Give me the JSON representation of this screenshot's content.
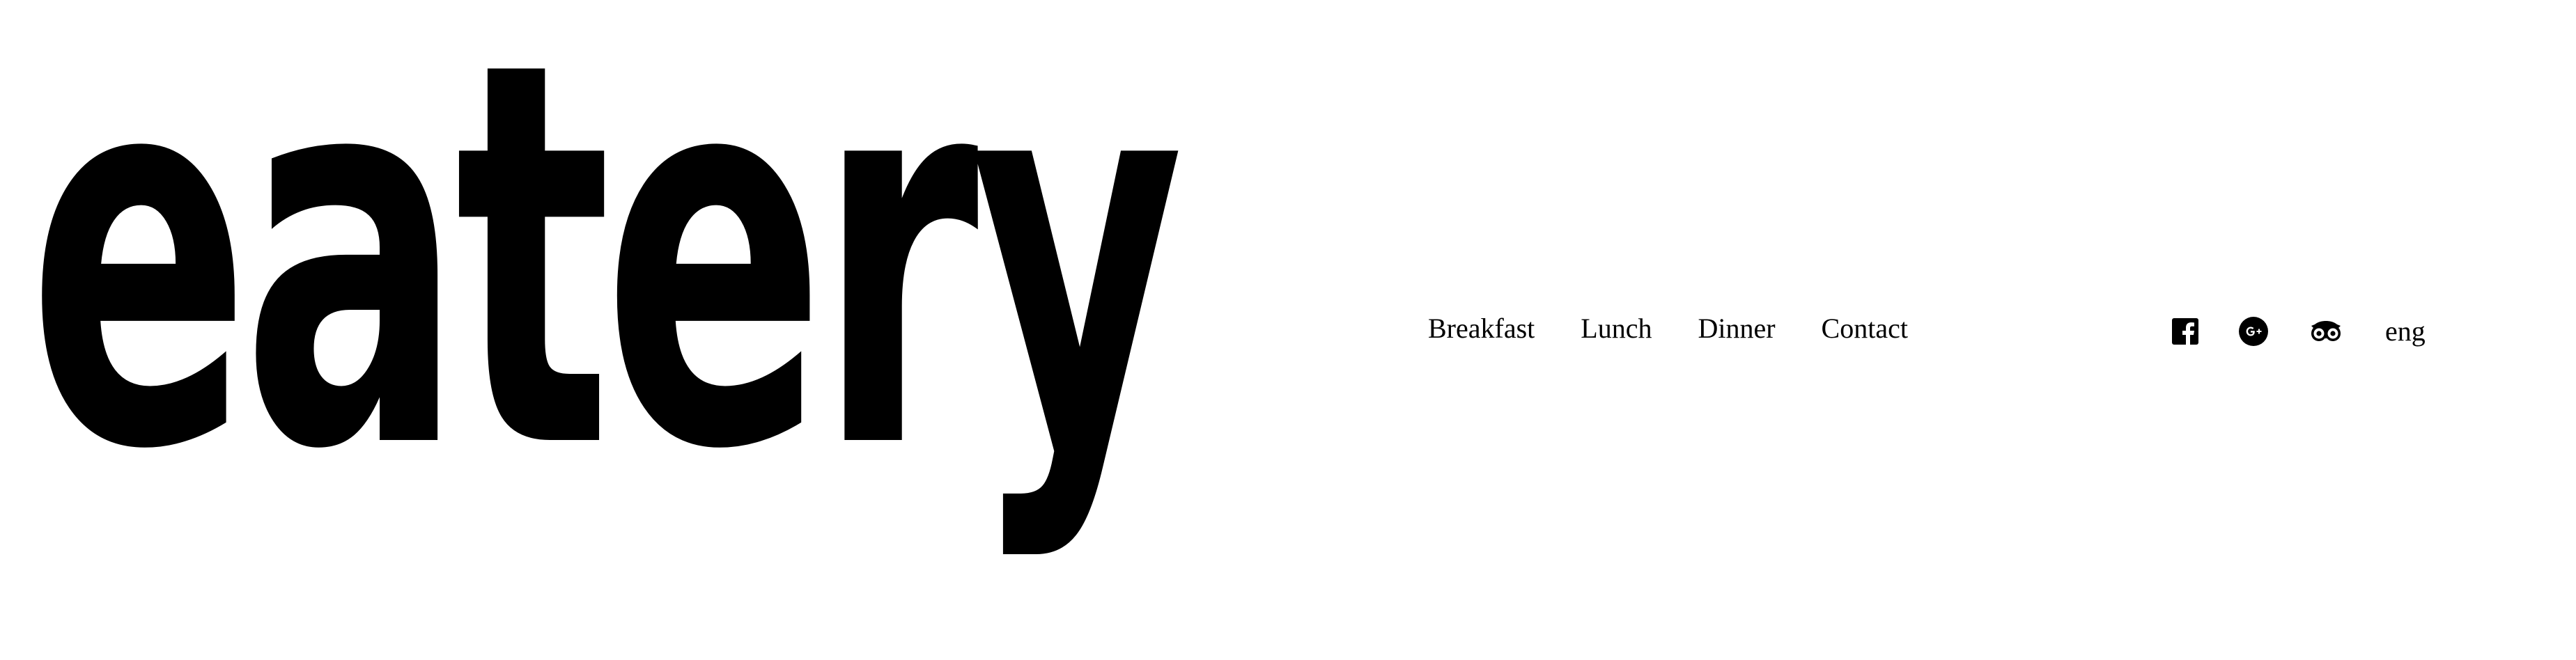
{
  "header": {
    "logo_text": "eatery",
    "nav": [
      {
        "label": "Breakfast"
      },
      {
        "label": "Lunch"
      },
      {
        "label": "Dinner"
      },
      {
        "label": "Contact"
      }
    ],
    "social": [
      {
        "icon": "facebook-icon"
      },
      {
        "icon": "google-plus-icon"
      },
      {
        "icon": "tripadvisor-icon"
      }
    ],
    "language": "eng"
  },
  "colors": {
    "background": "#ffffff",
    "text": "#000000"
  }
}
